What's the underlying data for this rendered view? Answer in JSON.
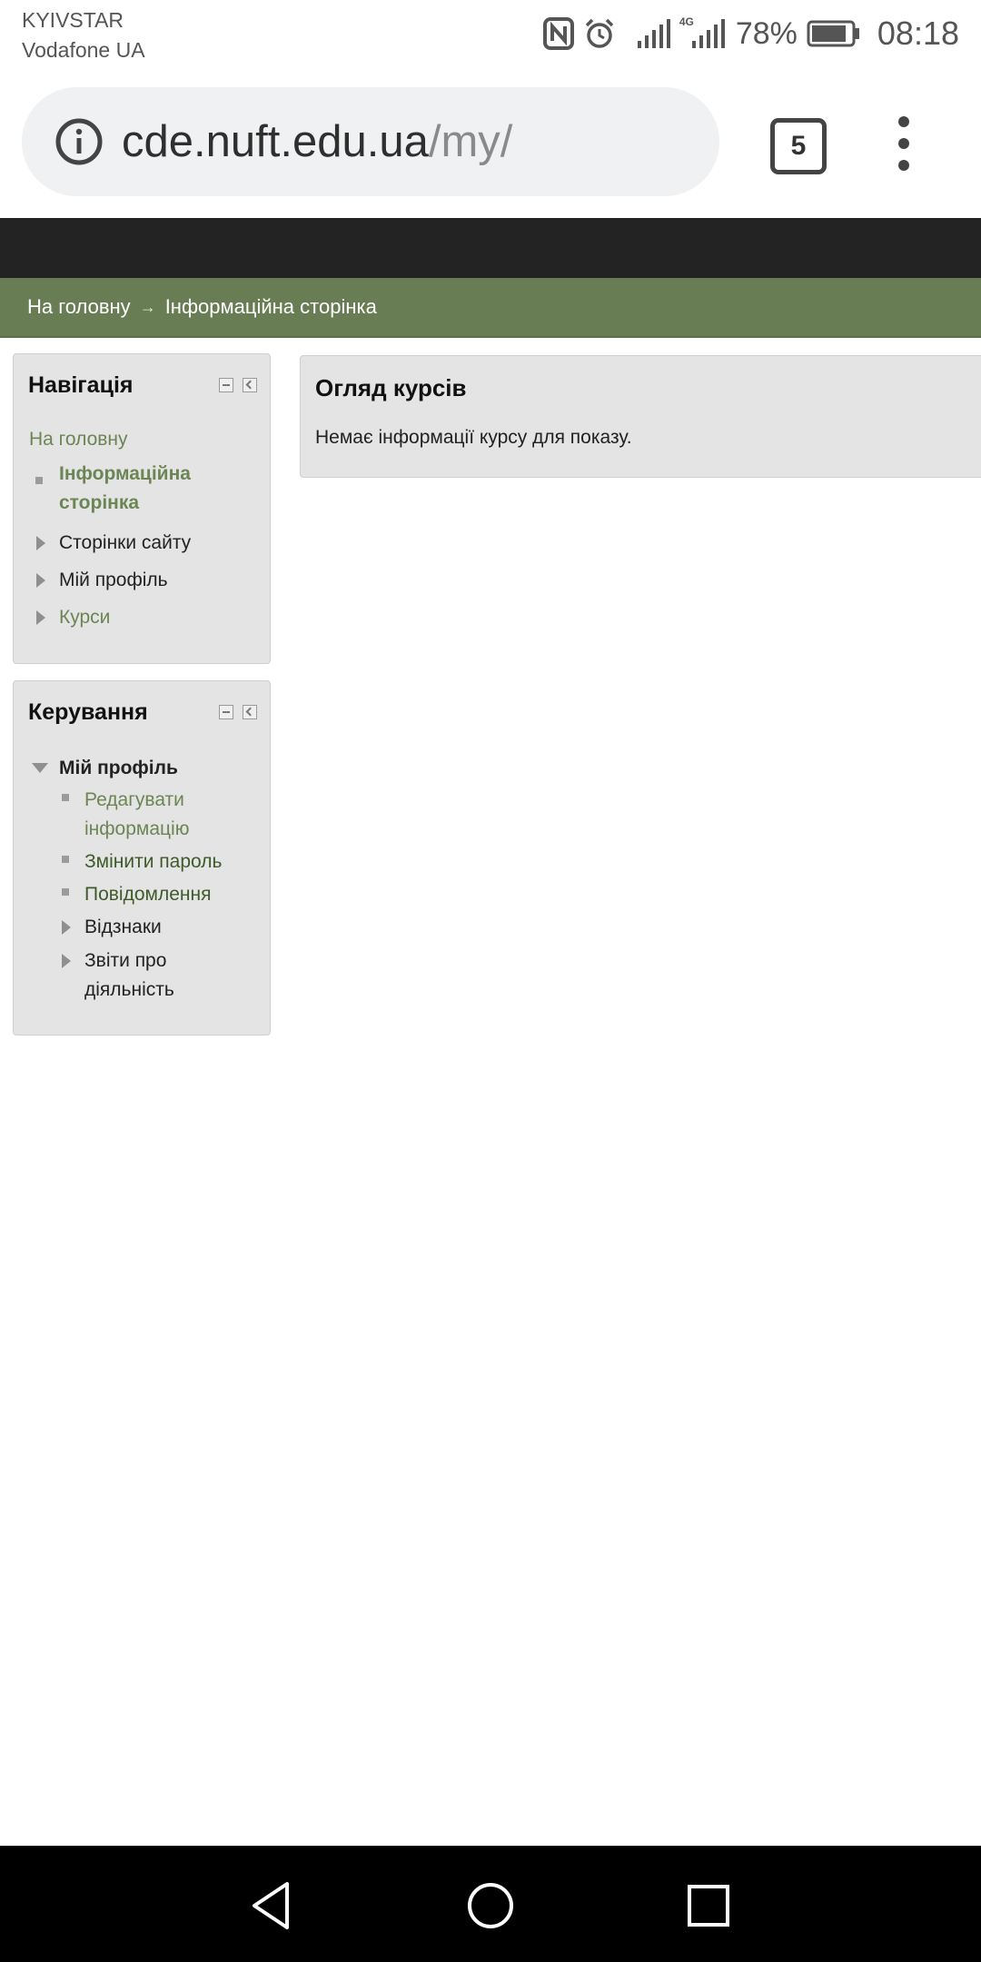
{
  "status_bar": {
    "carrier_1": "KYIVSTAR",
    "carrier_2": "Vodafone UA",
    "network": "4G",
    "battery": "78%",
    "time": "08:18"
  },
  "browser": {
    "url_host": "cde.nuft.edu.ua",
    "url_path": "/my/",
    "tab_count": "5"
  },
  "breadcrumb": {
    "home": "На головну",
    "separator": "→",
    "current": "Інформаційна сторінка"
  },
  "navigation_block": {
    "title": "Навігація",
    "home_link": "На головну",
    "items": [
      {
        "label": "Інформаційна сторінка",
        "line1": "Інформаційна",
        "line2": "сторінка"
      },
      {
        "label": "Сторінки сайту"
      },
      {
        "label": "Мій профіль"
      },
      {
        "label": "Курси"
      }
    ]
  },
  "admin_block": {
    "title": "Керування",
    "section": "Мій профіль",
    "items": [
      {
        "line1": "Редагувати",
        "line2": "інформацію"
      },
      {
        "label": "Змінити пароль"
      },
      {
        "label": "Повідомлення"
      },
      {
        "label": "Відзнаки"
      },
      {
        "line1": "Звіти про",
        "line2": "діяльність"
      }
    ]
  },
  "main": {
    "title": "Огляд курсів",
    "message": "Немає інформації курсу для показу."
  },
  "colors": {
    "breadcrumb_bg": "#687d53",
    "header_dark": "#232323",
    "block_bg": "#e4e4e4",
    "link_green": "#6c8555"
  }
}
